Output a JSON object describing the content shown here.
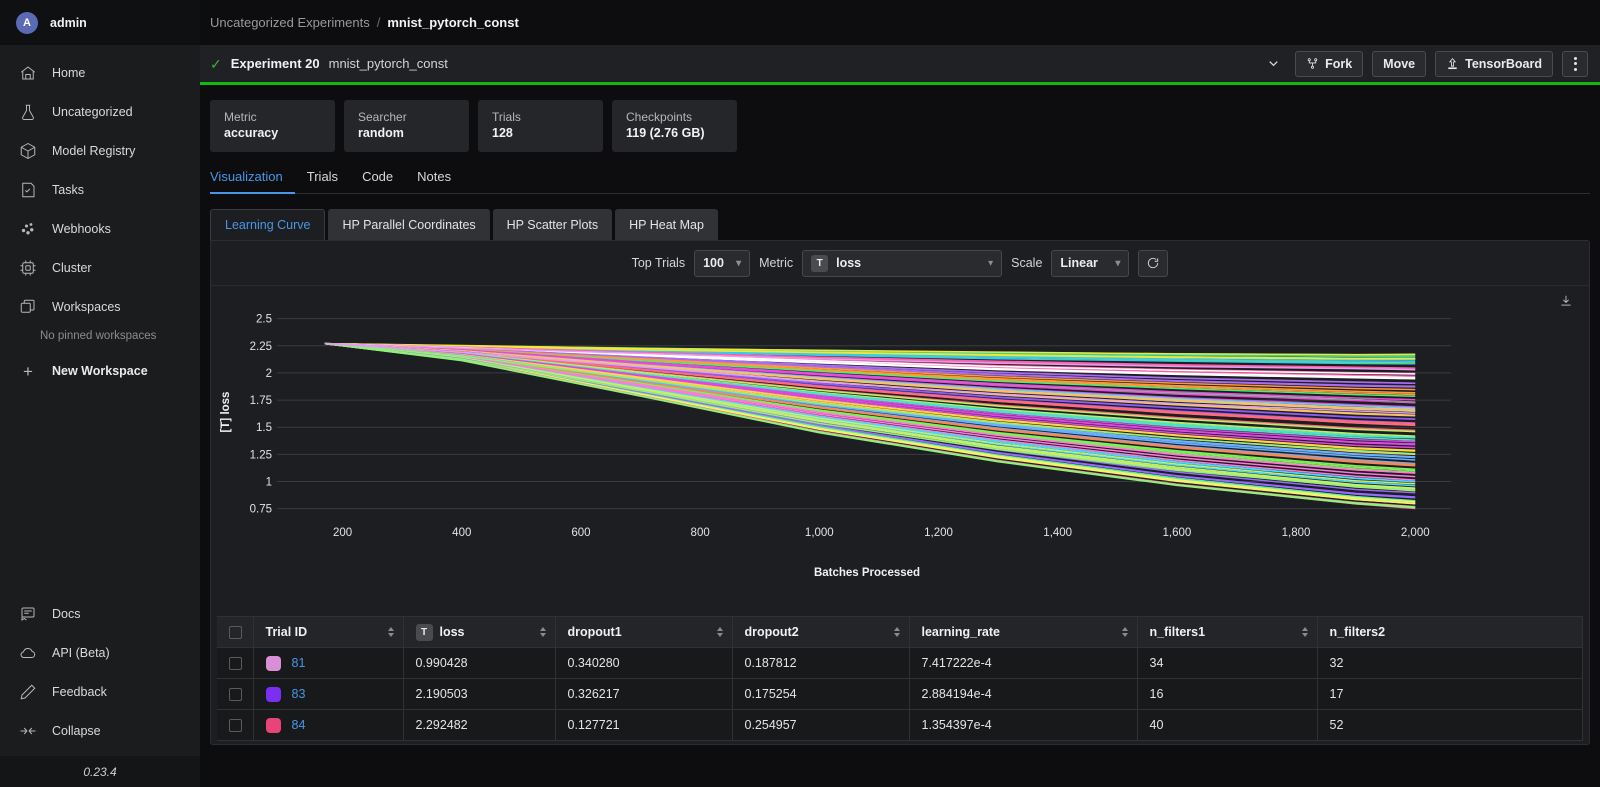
{
  "sidebar": {
    "user": {
      "initial": "A",
      "name": "admin"
    },
    "items": [
      {
        "label": "Home",
        "icon": "home-icon"
      },
      {
        "label": "Uncategorized",
        "icon": "flask-icon"
      },
      {
        "label": "Model Registry",
        "icon": "cube-icon"
      },
      {
        "label": "Tasks",
        "icon": "tasks-icon"
      },
      {
        "label": "Webhooks",
        "icon": "webhooks-icon"
      },
      {
        "label": "Cluster",
        "icon": "chip-icon"
      },
      {
        "label": "Workspaces",
        "icon": "workspaces-icon"
      }
    ],
    "no_pinned": "No pinned workspaces",
    "new_workspace": "New Workspace",
    "bottom_items": [
      {
        "label": "Docs",
        "icon": "book-icon"
      },
      {
        "label": "API (Beta)",
        "icon": "cloud-icon"
      },
      {
        "label": "Feedback",
        "icon": "pencil-icon"
      },
      {
        "label": "Collapse",
        "icon": "collapse-icon"
      }
    ],
    "version": "0.23.4"
  },
  "breadcrumb": {
    "parent": "Uncategorized Experiments",
    "separator": "/",
    "current": "mnist_pytorch_const"
  },
  "experiment_header": {
    "status_icon": "check-icon",
    "title": "Experiment 20",
    "name": "mnist_pytorch_const",
    "chevron": "chevron-down-icon",
    "fork_label": "Fork",
    "move_label": "Move",
    "tensorboard_label": "TensorBoard",
    "accent_color": "#12b912"
  },
  "cards": [
    {
      "label": "Metric",
      "value": "accuracy"
    },
    {
      "label": "Searcher",
      "value": "random"
    },
    {
      "label": "Trials",
      "value": "128"
    },
    {
      "label": "Checkpoints",
      "value": "119 (2.76 GB)"
    }
  ],
  "tabs": [
    {
      "label": "Visualization",
      "active": true
    },
    {
      "label": "Trials",
      "active": false
    },
    {
      "label": "Code",
      "active": false
    },
    {
      "label": "Notes",
      "active": false
    }
  ],
  "subtabs": [
    {
      "label": "Learning Curve",
      "active": true
    },
    {
      "label": "HP Parallel Coordinates",
      "active": false
    },
    {
      "label": "HP Scatter Plots",
      "active": false
    },
    {
      "label": "HP Heat Map",
      "active": false
    }
  ],
  "chart_toolbar": {
    "top_trials_label": "Top Trials",
    "top_trials_value": "100",
    "metric_label": "Metric",
    "metric_badge": "T",
    "metric_value": "loss",
    "scale_label": "Scale",
    "scale_value": "Linear",
    "refresh_icon": "refresh-icon",
    "download_icon": "download-icon"
  },
  "chart_data": {
    "type": "line",
    "title": "",
    "xlabel": "Batches Processed",
    "ylabel": "[T] loss",
    "xlim": [
      100,
      2060
    ],
    "ylim": [
      0.7,
      2.58
    ],
    "x_ticks": [
      200,
      400,
      600,
      800,
      1000,
      1200,
      1400,
      1600,
      1800,
      2000
    ],
    "x_tick_labels": [
      "200",
      "400",
      "600",
      "800",
      "1,000",
      "1,200",
      "1,400",
      "1,600",
      "1,800",
      "2,000"
    ],
    "y_ticks": [
      0.75,
      1,
      1.25,
      1.5,
      1.75,
      2,
      2.25,
      2.5
    ],
    "y_tick_labels": [
      "0.75",
      "1",
      "1.25",
      "1.5",
      "1.75",
      "2",
      "2.25",
      "2.5"
    ],
    "grid": true,
    "legend": "none",
    "series_count": 100,
    "x": [
      170,
      400,
      700,
      1000,
      1300,
      1600,
      1900,
      2000
    ],
    "series": [
      {
        "name": "t0",
        "color": "#7fe04a",
        "values": [
          2.27,
          2.24,
          2.21,
          2.18,
          2.16,
          2.14,
          2.12,
          2.12
        ]
      },
      {
        "name": "t1",
        "color": "#2fd4a0",
        "values": [
          2.27,
          2.25,
          2.23,
          2.21,
          2.19,
          2.18,
          2.17,
          2.17
        ]
      },
      {
        "name": "t2",
        "color": "#36c9f0",
        "values": [
          2.27,
          2.24,
          2.2,
          2.17,
          2.14,
          2.12,
          2.1,
          2.1
        ]
      },
      {
        "name": "t3",
        "color": "#f0e53a",
        "values": [
          2.27,
          2.25,
          2.22,
          2.2,
          2.18,
          2.16,
          2.15,
          2.15
        ]
      },
      {
        "name": "t4",
        "color": "#ff5ea8",
        "values": [
          2.27,
          2.23,
          2.17,
          2.11,
          2.06,
          2.02,
          1.99,
          1.98
        ]
      },
      {
        "name": "t5",
        "color": "#ffffff",
        "values": [
          2.27,
          2.23,
          2.16,
          2.1,
          2.04,
          2.0,
          1.97,
          1.96
        ]
      },
      {
        "name": "t6",
        "color": "#a96df0",
        "values": [
          2.27,
          2.22,
          2.14,
          2.06,
          1.99,
          1.93,
          1.89,
          1.88
        ]
      },
      {
        "name": "t7",
        "color": "#ff9a3c",
        "values": [
          2.27,
          2.22,
          2.13,
          2.04,
          1.96,
          1.9,
          1.85,
          1.84
        ]
      },
      {
        "name": "t8",
        "color": "#4aee7a",
        "values": [
          2.27,
          2.21,
          2.1,
          2.0,
          1.9,
          1.83,
          1.77,
          1.75
        ]
      },
      {
        "name": "t9",
        "color": "#e84ad8",
        "values": [
          2.27,
          2.21,
          2.09,
          1.98,
          1.88,
          1.8,
          1.74,
          1.72
        ]
      },
      {
        "name": "t10",
        "color": "#59d0ff",
        "values": [
          2.27,
          2.2,
          2.07,
          1.95,
          1.84,
          1.75,
          1.68,
          1.66
        ]
      },
      {
        "name": "t11",
        "color": "#f5c26b",
        "values": [
          2.27,
          2.2,
          2.06,
          1.93,
          1.81,
          1.72,
          1.64,
          1.62
        ]
      },
      {
        "name": "t12",
        "color": "#8f5cf5",
        "values": [
          2.27,
          2.19,
          2.04,
          1.89,
          1.76,
          1.66,
          1.57,
          1.55
        ]
      },
      {
        "name": "t13",
        "color": "#ff6b7a",
        "values": [
          2.27,
          2.19,
          2.03,
          1.87,
          1.74,
          1.63,
          1.54,
          1.52
        ]
      },
      {
        "name": "t14",
        "color": "#b8f06a",
        "values": [
          2.27,
          2.18,
          2.0,
          1.83,
          1.68,
          1.56,
          1.46,
          1.44
        ]
      },
      {
        "name": "t15",
        "color": "#52e0c4",
        "values": [
          2.27,
          2.18,
          1.99,
          1.81,
          1.65,
          1.52,
          1.42,
          1.4
        ]
      },
      {
        "name": "t16",
        "color": "#d94ae0",
        "values": [
          2.27,
          2.17,
          1.97,
          1.77,
          1.6,
          1.46,
          1.35,
          1.33
        ]
      },
      {
        "name": "t17",
        "color": "#ffd24a",
        "values": [
          2.27,
          2.17,
          1.96,
          1.75,
          1.57,
          1.43,
          1.31,
          1.29
        ]
      },
      {
        "name": "t18",
        "color": "#6ab0ff",
        "values": [
          2.27,
          2.16,
          1.93,
          1.71,
          1.52,
          1.36,
          1.24,
          1.21
        ]
      },
      {
        "name": "t19",
        "color": "#f08a5d",
        "values": [
          2.27,
          2.16,
          1.92,
          1.69,
          1.49,
          1.33,
          1.2,
          1.17
        ]
      },
      {
        "name": "t20",
        "color": "#7ef05a",
        "values": [
          2.27,
          2.15,
          1.9,
          1.65,
          1.44,
          1.27,
          1.13,
          1.1
        ]
      },
      {
        "name": "t21",
        "color": "#ff7ad9",
        "values": [
          2.27,
          2.15,
          1.89,
          1.63,
          1.42,
          1.24,
          1.1,
          1.07
        ]
      },
      {
        "name": "t22",
        "color": "#4ad6ff",
        "values": [
          2.27,
          2.14,
          1.86,
          1.59,
          1.36,
          1.17,
          1.02,
          0.99
        ]
      },
      {
        "name": "t23",
        "color": "#c3f06a",
        "values": [
          2.27,
          2.14,
          1.85,
          1.57,
          1.33,
          1.14,
          0.98,
          0.95
        ]
      },
      {
        "name": "t24",
        "color": "#9a6aff",
        "values": [
          2.27,
          2.13,
          1.83,
          1.53,
          1.28,
          1.07,
          0.91,
          0.88
        ]
      },
      {
        "name": "t25",
        "color": "#5af0a0",
        "values": [
          2.27,
          2.12,
          1.81,
          1.5,
          1.24,
          1.03,
          0.86,
          0.82
        ]
      },
      {
        "name": "t26",
        "color": "#f5f06a",
        "values": [
          2.27,
          2.12,
          1.8,
          1.48,
          1.22,
          1.0,
          0.83,
          0.79
        ]
      },
      {
        "name": "t27",
        "color": "#ff5ea8",
        "values": [
          2.27,
          2.12,
          1.79,
          1.46,
          1.19,
          0.97,
          0.8,
          0.76
        ]
      },
      {
        "name": "t28",
        "color": "#8ff07a",
        "values": [
          2.27,
          2.11,
          1.78,
          1.44,
          1.17,
          0.95,
          0.78,
          0.74
        ]
      },
      {
        "name": "t29",
        "color": "#e0a0f0",
        "values": [
          2.27,
          2.23,
          2.18,
          2.13,
          2.09,
          2.06,
          2.04,
          2.03
        ]
      }
    ]
  },
  "table": {
    "columns": [
      {
        "key": "checkbox",
        "label": "",
        "sortable": false
      },
      {
        "key": "trial_id",
        "label": "Trial ID",
        "sortable": true
      },
      {
        "key": "loss",
        "label": "loss",
        "badge": "T",
        "sortable": true
      },
      {
        "key": "dropout1",
        "label": "dropout1",
        "sortable": true
      },
      {
        "key": "dropout2",
        "label": "dropout2",
        "sortable": true
      },
      {
        "key": "learning_rate",
        "label": "learning_rate",
        "sortable": true
      },
      {
        "key": "n_filters1",
        "label": "n_filters1",
        "sortable": true
      },
      {
        "key": "n_filters2",
        "label": "n_filters2",
        "sortable": false
      }
    ],
    "rows": [
      {
        "trial_id": "81",
        "color": "#d98fd6",
        "loss": "0.990428",
        "dropout1": "0.340280",
        "dropout2": "0.187812",
        "learning_rate": "7.417222e-4",
        "n_filters1": "34",
        "n_filters2": "32"
      },
      {
        "trial_id": "83",
        "color": "#7b2ff2",
        "loss": "2.190503",
        "dropout1": "0.326217",
        "dropout2": "0.175254",
        "learning_rate": "2.884194e-4",
        "n_filters1": "16",
        "n_filters2": "17"
      },
      {
        "trial_id": "84",
        "color": "#e8447a",
        "loss": "2.292482",
        "dropout1": "0.127721",
        "dropout2": "0.254957",
        "learning_rate": "1.354397e-4",
        "n_filters1": "40",
        "n_filters2": "52"
      }
    ]
  }
}
